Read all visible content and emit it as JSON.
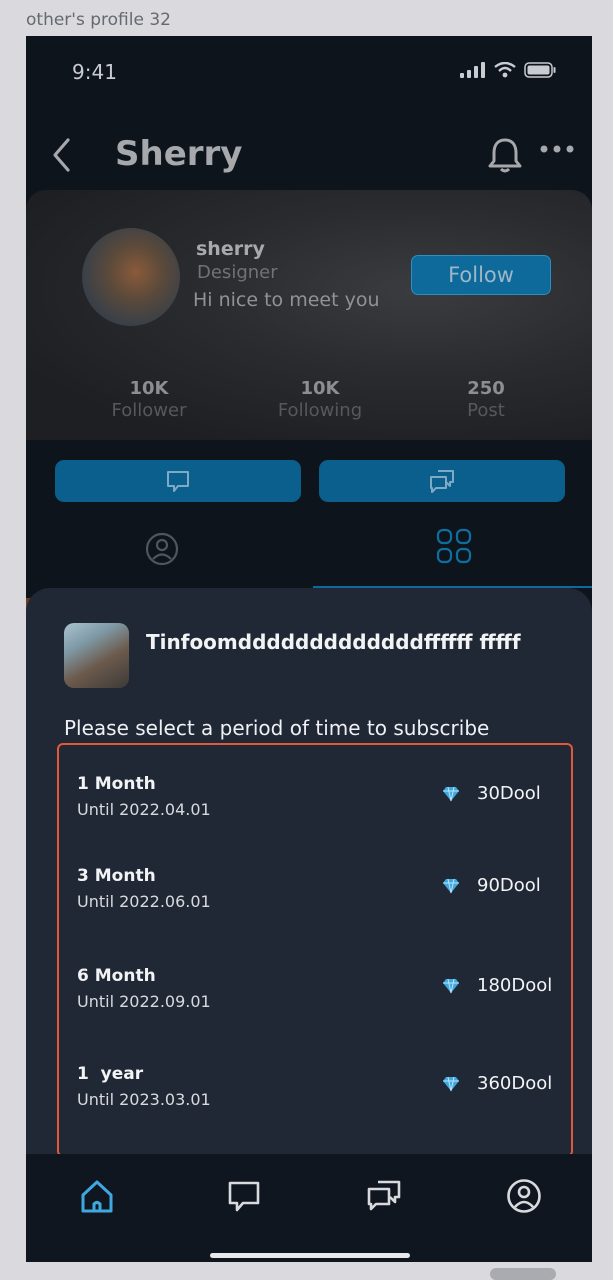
{
  "frame_label": "other's profile 32",
  "status_bar": {
    "time": "9:41"
  },
  "header": {
    "title": "Sherry"
  },
  "profile": {
    "name": "sherry",
    "role": "Designer",
    "bio": "Hi nice to meet you",
    "follow_label": "Follow",
    "stats": [
      {
        "value": "10K",
        "label": "Follower"
      },
      {
        "value": "10K",
        "label": "Following"
      },
      {
        "value": "250",
        "label": "Post"
      }
    ]
  },
  "subscribe_sheet": {
    "creator_name": "Tinfoomdddddddddddddffffff fffff",
    "prompt": "Please select a period of time to subscribe",
    "plans": [
      {
        "title": "1 Month",
        "until": "Until 2022.04.01",
        "price": "30Dool"
      },
      {
        "title": "3 Month",
        "until": "Until 2022.06.01",
        "price": "90Dool"
      },
      {
        "title": "6 Month",
        "until": "Until 2022.09.01",
        "price": "180Dool"
      },
      {
        "title": "1  year",
        "until": "Until 2023.03.01",
        "price": "360Dool"
      }
    ]
  },
  "colors": {
    "accent": "#0d6a9a",
    "highlight_border": "#e2583c",
    "diamond": "#3fa8e0",
    "active_nav": "#3fa8e0"
  },
  "icons": {
    "nav": [
      "home-icon",
      "chat-bubble-icon",
      "chats-icon",
      "profile-icon"
    ]
  }
}
